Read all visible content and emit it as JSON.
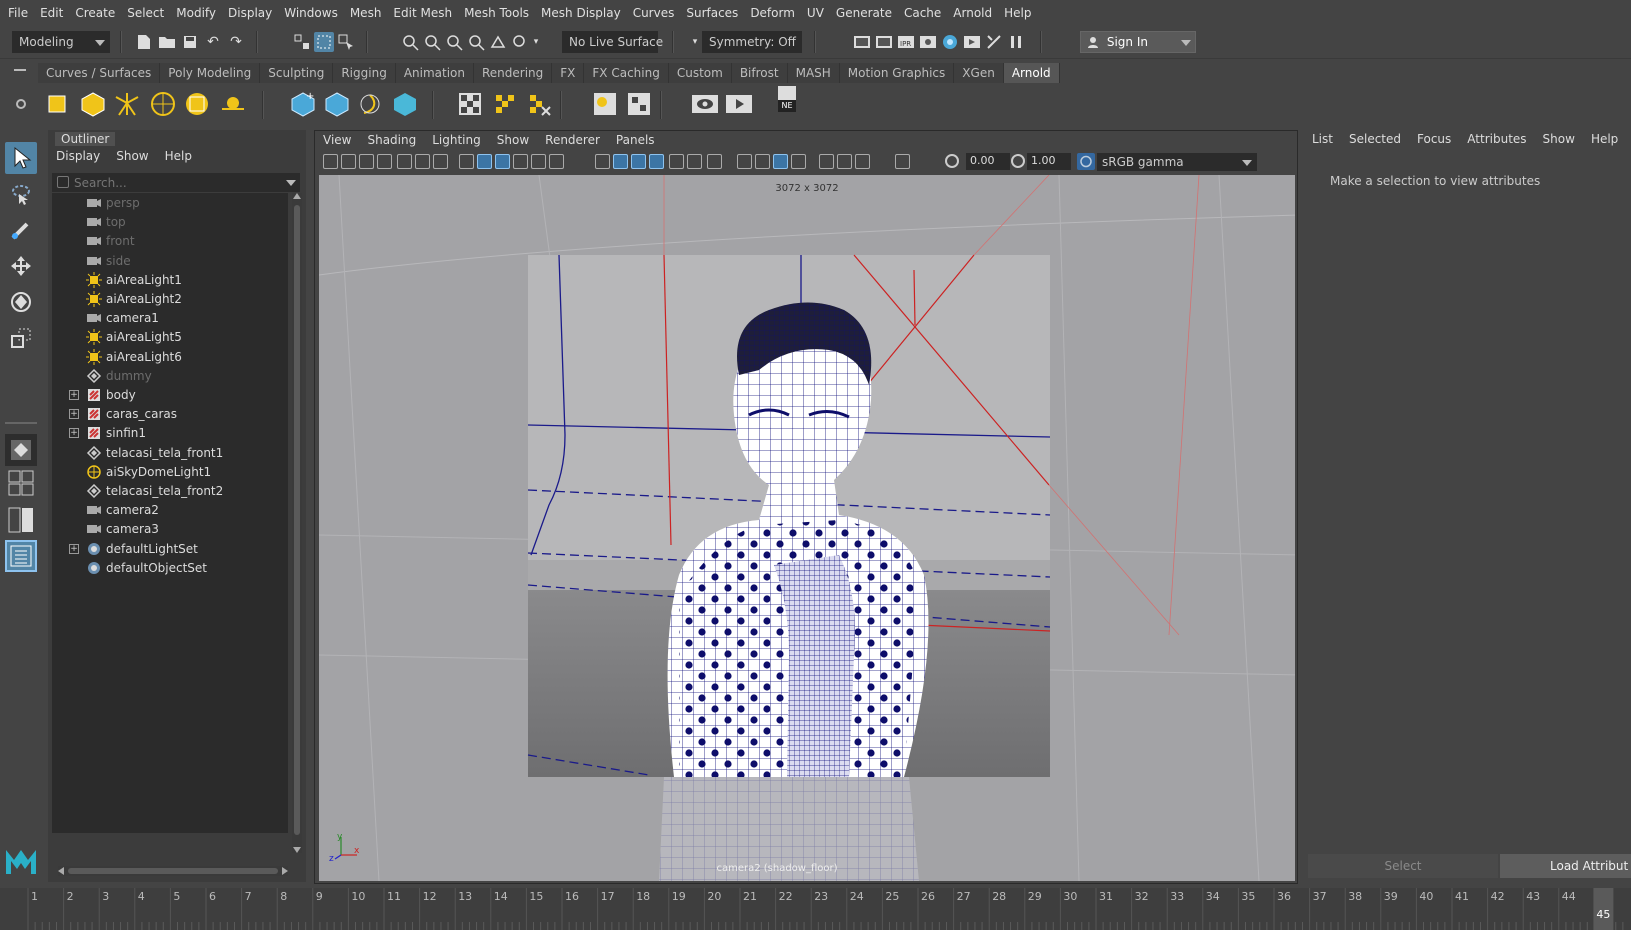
{
  "menubar": [
    "File",
    "Edit",
    "Create",
    "Select",
    "Modify",
    "Display",
    "Windows",
    "Mesh",
    "Edit Mesh",
    "Mesh Tools",
    "Mesh Display",
    "Curves",
    "Surfaces",
    "Deform",
    "UV",
    "Generate",
    "Cache",
    "Arnold",
    "Help"
  ],
  "statusline": {
    "mode": "Modeling",
    "live_surface": "No Live Surface",
    "symmetry": "Symmetry: Off",
    "sign_in": "Sign In"
  },
  "shelf": {
    "tabs": [
      "Curves / Surfaces",
      "Poly Modeling",
      "Sculpting",
      "Rigging",
      "Animation",
      "Rendering",
      "FX",
      "FX Caching",
      "Custom",
      "Bifrost",
      "MASH",
      "Motion Graphics",
      "XGen",
      "Arnold"
    ],
    "active_tab": "Arnold",
    "ne_badge": "NE"
  },
  "outliner": {
    "title": "Outliner",
    "menu": [
      "Display",
      "Show",
      "Help"
    ],
    "search_placeholder": "Search...",
    "items": [
      {
        "label": "persp",
        "icon": "camera-icon",
        "dim": true,
        "expandable": false
      },
      {
        "label": "top",
        "icon": "camera-icon",
        "dim": true,
        "expandable": false
      },
      {
        "label": "front",
        "icon": "camera-icon",
        "dim": true,
        "expandable": false
      },
      {
        "label": "side",
        "icon": "camera-icon",
        "dim": true,
        "expandable": false
      },
      {
        "label": "aiAreaLight1",
        "icon": "area-light-icon",
        "dim": false,
        "expandable": false
      },
      {
        "label": "aiAreaLight2",
        "icon": "area-light-icon",
        "dim": false,
        "expandable": false
      },
      {
        "label": "camera1",
        "icon": "camera-icon",
        "dim": false,
        "expandable": false
      },
      {
        "label": "aiAreaLight5",
        "icon": "area-light-icon",
        "dim": false,
        "expandable": false
      },
      {
        "label": "aiAreaLight6",
        "icon": "area-light-icon",
        "dim": false,
        "expandable": false
      },
      {
        "label": "dummy",
        "icon": "transform-icon",
        "dim": true,
        "expandable": false
      },
      {
        "label": "body",
        "icon": "group-icon",
        "dim": false,
        "expandable": true
      },
      {
        "label": "caras_caras",
        "icon": "group-icon",
        "dim": false,
        "expandable": true
      },
      {
        "label": "sinfin1",
        "icon": "group-icon",
        "dim": false,
        "expandable": true
      },
      {
        "label": "telacasi_tela_front1",
        "icon": "transform-icon",
        "dim": false,
        "expandable": false
      },
      {
        "label": "aiSkyDomeLight1",
        "icon": "skydome-icon",
        "dim": false,
        "expandable": false
      },
      {
        "label": "telacasi_tela_front2",
        "icon": "transform-icon",
        "dim": false,
        "expandable": false
      },
      {
        "label": "camera2",
        "icon": "camera-icon",
        "dim": false,
        "expandable": false
      },
      {
        "label": "camera3",
        "icon": "camera-icon",
        "dim": false,
        "expandable": false
      },
      {
        "label": "defaultLightSet",
        "icon": "set-icon",
        "dim": false,
        "expandable": true
      },
      {
        "label": "defaultObjectSet",
        "icon": "set-icon",
        "dim": false,
        "expandable": false
      }
    ]
  },
  "viewport": {
    "menu": [
      "View",
      "Shading",
      "Lighting",
      "Show",
      "Renderer",
      "Panels"
    ],
    "field_exposure": "0.00",
    "field_gamma": "1.00",
    "color_space": "sRGB gamma",
    "resolution": "3072 x 3072",
    "camera_label": "camera2 (shadow_floor)"
  },
  "attribute_editor": {
    "menu": [
      "List",
      "Selected",
      "Focus",
      "Attributes",
      "Show",
      "Help"
    ],
    "message": "Make a selection to view attributes",
    "select_button": "Select",
    "load_button": "Load Attribut"
  },
  "timeline": {
    "ticks": [
      "1",
      "2",
      "3",
      "4",
      "5",
      "6",
      "7",
      "8",
      "9",
      "10",
      "11",
      "12",
      "13",
      "14",
      "15",
      "16",
      "17",
      "18",
      "19",
      "20",
      "21",
      "22",
      "23",
      "24",
      "25",
      "26",
      "27",
      "28",
      "29",
      "30",
      "31",
      "32",
      "33",
      "34",
      "35",
      "36",
      "37",
      "38",
      "39",
      "40",
      "41",
      "42",
      "43",
      "44",
      "45"
    ],
    "current_frame": "45"
  },
  "colors": {
    "wire": "#0a0a7a",
    "active_tab": "#565656",
    "selected_tool": "#3a6ea5"
  }
}
